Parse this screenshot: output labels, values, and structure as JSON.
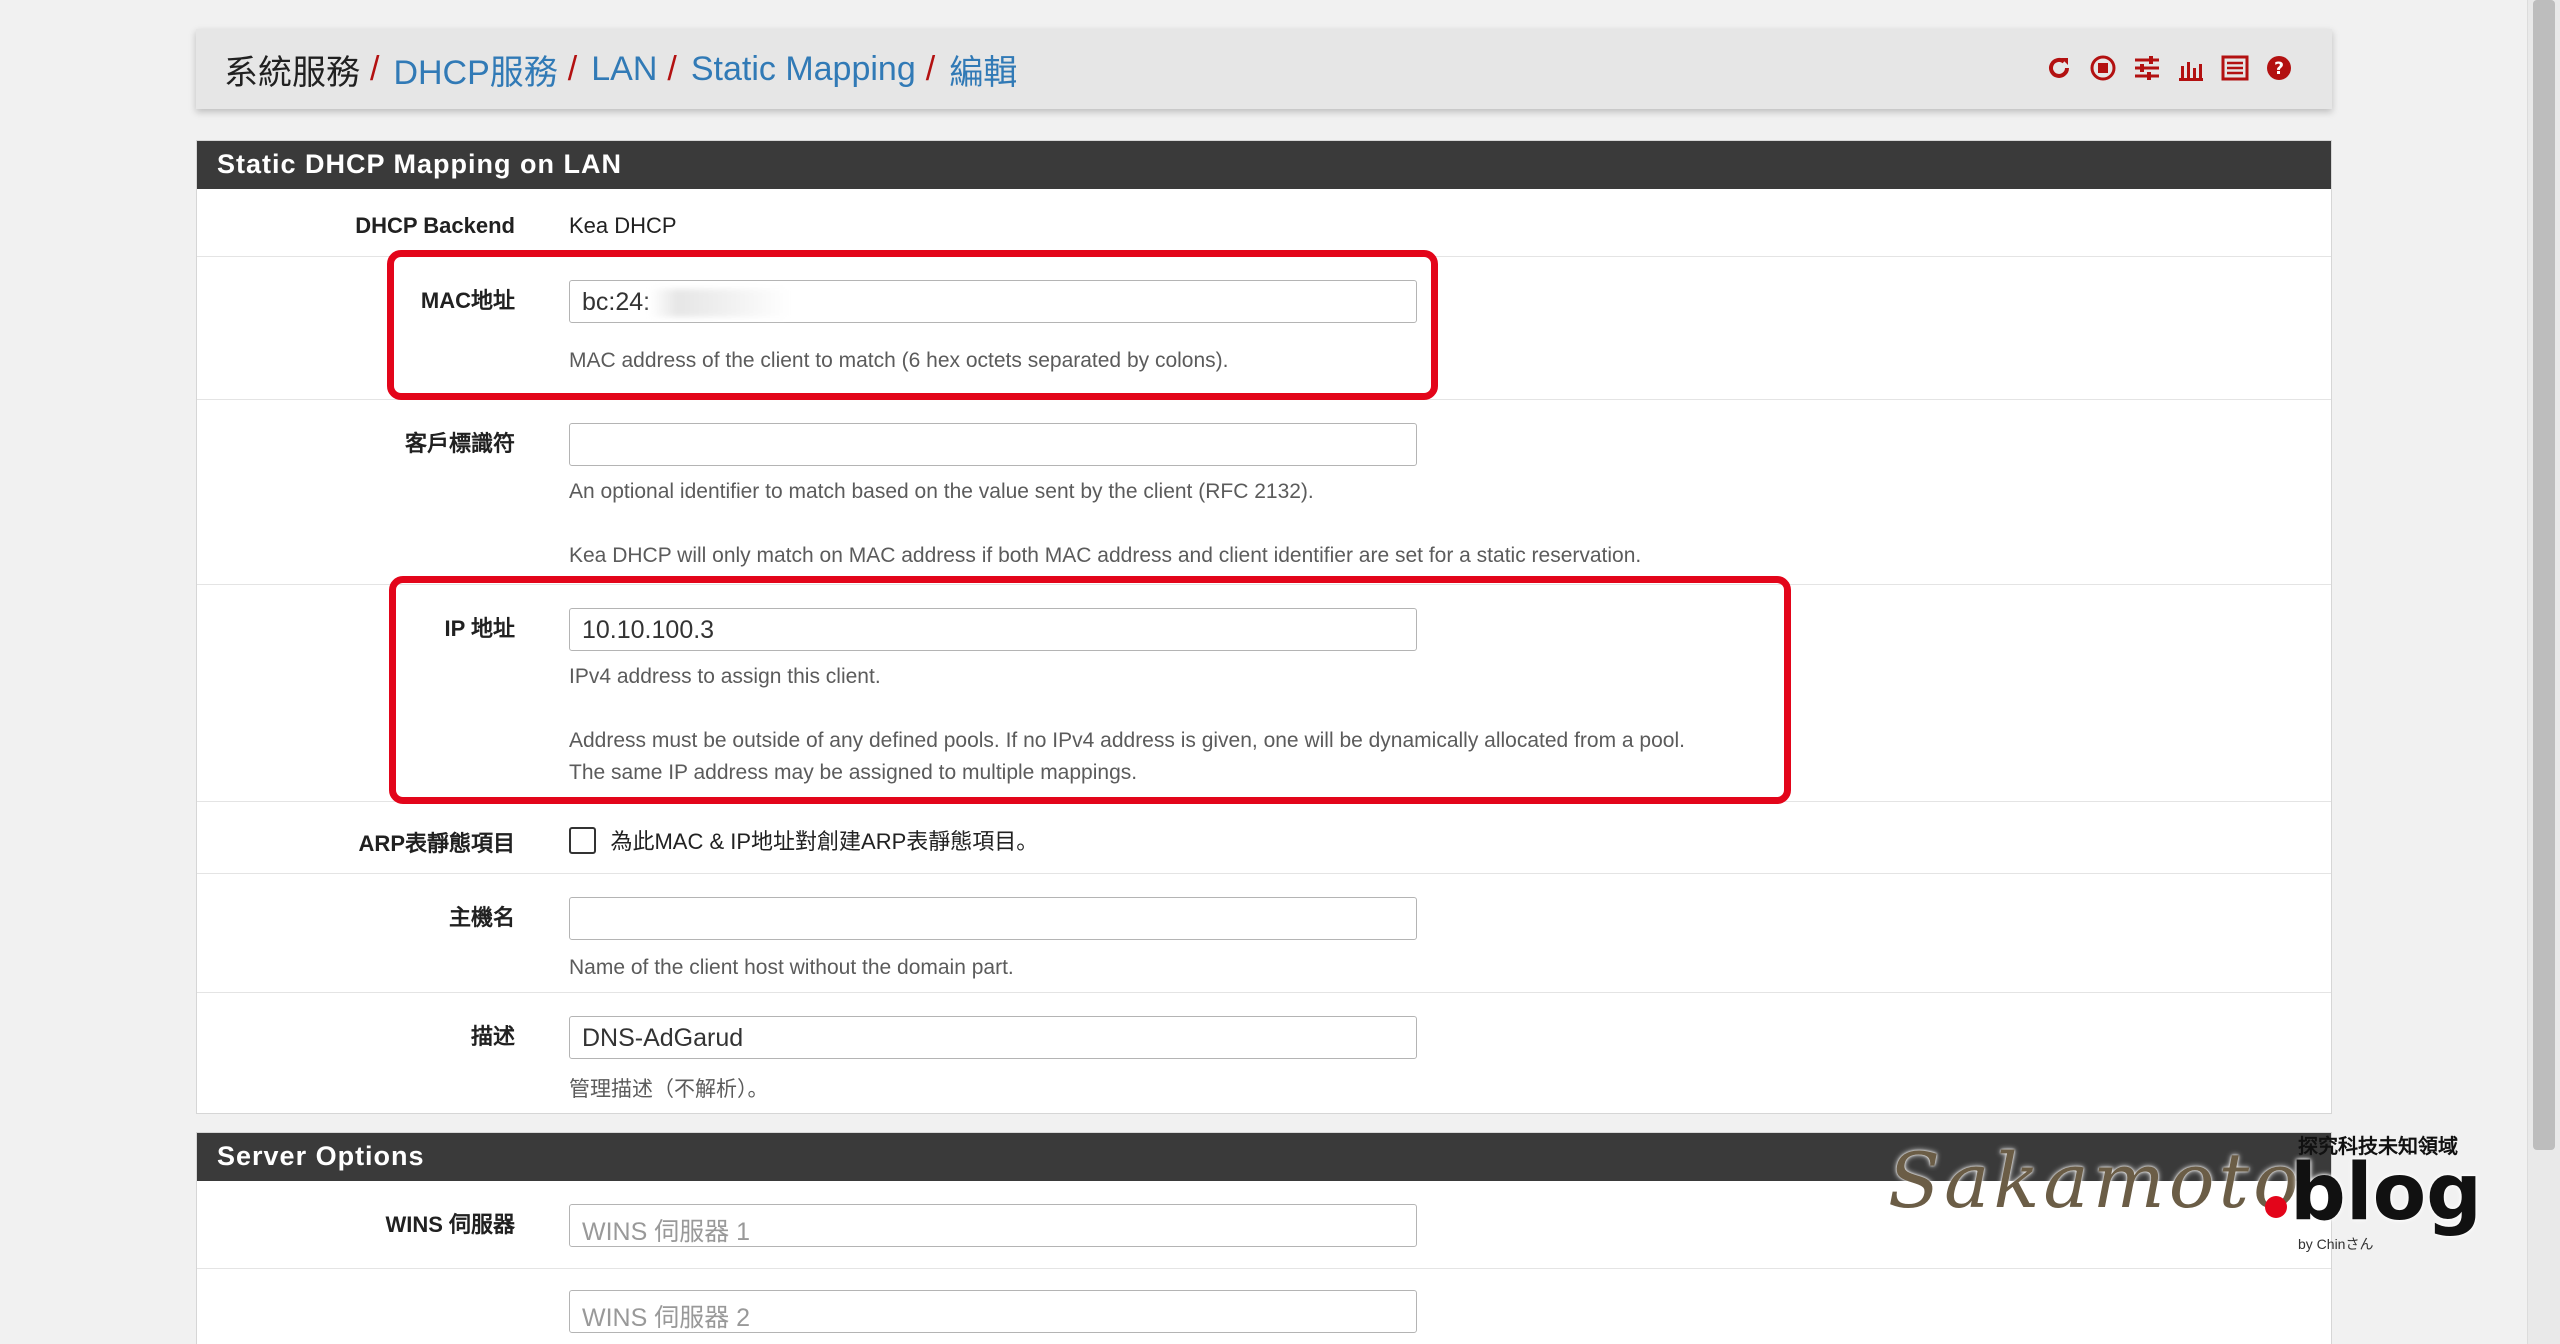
{
  "breadcrumb": {
    "items": [
      "系統服務",
      "DHCP服務",
      "LAN",
      "Static Mapping",
      "編輯"
    ],
    "separator": "/"
  },
  "toolbar_icons": [
    "reload-icon",
    "stop-icon",
    "settings-sliders-icon",
    "chart-icon",
    "log-list-icon",
    "help-icon"
  ],
  "colors": {
    "accent_red": "#b31111",
    "link_blue": "#317ab6",
    "panel_header": "#3a3a3a",
    "highlight_box": "#e3051a"
  },
  "panel_main": {
    "title": "Static DHCP Mapping on LAN",
    "backend": {
      "label": "DHCP Backend",
      "value": "Kea DHCP"
    },
    "mac": {
      "label": "MAC地址",
      "value": "bc:24:",
      "help": "MAC address of the client to match (6 hex octets separated by colons)."
    },
    "client_id": {
      "label": "客戶標識符",
      "value": "",
      "help1": "An optional identifier to match based on the value sent by the client (RFC 2132).",
      "help2": "Kea DHCP will only match on MAC address if both MAC address and client identifier are set for a static reservation."
    },
    "ip": {
      "label": "IP 地址",
      "value": "10.10.100.3",
      "help1": "IPv4 address to assign this client.",
      "help2": "Address must be outside of any defined pools. If no IPv4 address is given, one will be dynamically allocated from a pool.",
      "help3": "The same IP address may be assigned to multiple mappings."
    },
    "arp": {
      "label": "ARP表靜態項目",
      "checkbox_label": "為此MAC & IP地址對創建ARP表靜態項目。",
      "checked": false
    },
    "hostname": {
      "label": "主機名",
      "value": "",
      "help": "Name of the client host without the domain part."
    },
    "description": {
      "label": "描述",
      "value": "DNS-AdGarud",
      "help": "管理描述（不解析）。"
    }
  },
  "panel_server": {
    "title": "Server Options",
    "wins": {
      "label": "WINS 伺服器",
      "placeholder1": "WINS 伺服器 1",
      "placeholder2": "WINS 伺服器 2"
    }
  },
  "watermark": {
    "signature": "Sakamoto",
    "brand": "blog",
    "tagline": "探究科技未知領域",
    "byline": "by Chinさん"
  }
}
